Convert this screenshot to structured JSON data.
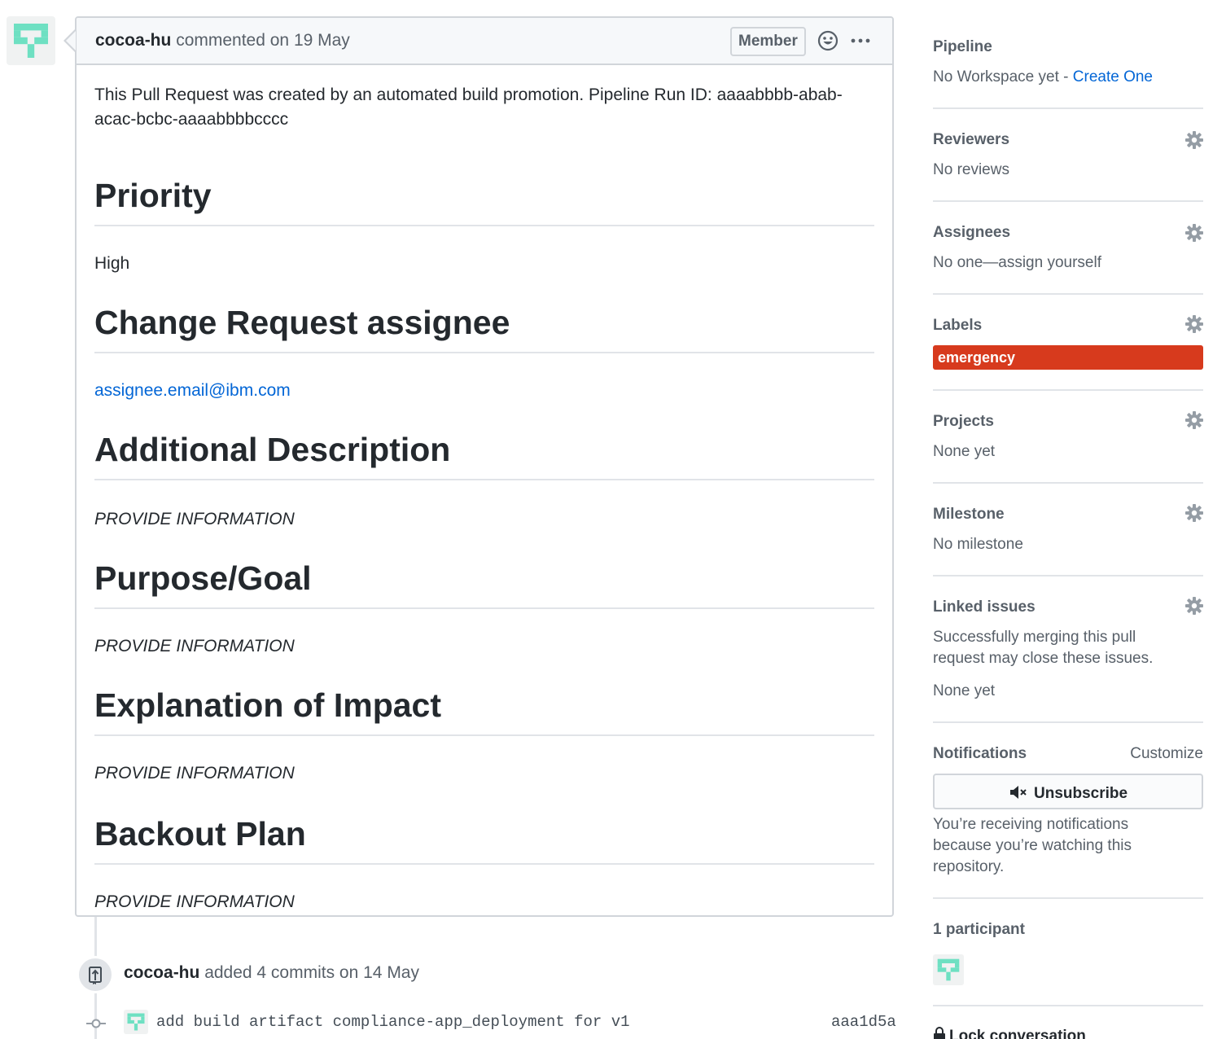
{
  "comment": {
    "author": "cocoa-hu",
    "action": "commented",
    "date": "on 19 May",
    "badge": "Member",
    "intro": "This Pull Request was created by an automated build promotion. Pipeline Run ID: aaaabbbb-abab-acac-bcbc-aaaabbbbcccc",
    "sections": [
      {
        "heading": "Priority",
        "value": "High"
      },
      {
        "heading": "Change Request assignee",
        "value": "assignee.email@ibm.com"
      },
      {
        "heading": "Additional Description",
        "value": "PROVIDE INFORMATION"
      },
      {
        "heading": "Purpose/Goal",
        "value": "PROVIDE INFORMATION"
      },
      {
        "heading": "Explanation of Impact",
        "value": "PROVIDE INFORMATION"
      },
      {
        "heading": "Backout Plan",
        "value": "PROVIDE INFORMATION"
      }
    ]
  },
  "timeline": {
    "event_author": "cocoa-hu",
    "event_text": "added 4 commits on 14 May",
    "commit_message": "add build artifact compliance-app_deployment for v1",
    "commit_sha": "aaa1d5a"
  },
  "sidebar": {
    "pipeline": {
      "title": "Pipeline",
      "value": "No Workspace yet - ",
      "link": "Create One"
    },
    "reviewers": {
      "title": "Reviewers",
      "value": "No reviews"
    },
    "assignees": {
      "title": "Assignees",
      "value": "No one—assign yourself"
    },
    "labels": {
      "title": "Labels",
      "items": [
        "emergency"
      ]
    },
    "projects": {
      "title": "Projects",
      "value": "None yet"
    },
    "milestone": {
      "title": "Milestone",
      "value": "No milestone"
    },
    "linked_issues": {
      "title": "Linked issues",
      "desc_line1": "Successfully merging this pull",
      "desc_line2": "request may close these issues.",
      "value": "None yet"
    },
    "notifications": {
      "title": "Notifications",
      "customize": "Customize",
      "button": "Unsubscribe",
      "reason_line1": "You’re receiving notifications",
      "reason_line2": "because you’re watching this",
      "reason_line3": "repository."
    },
    "participants": {
      "title": "1 participant"
    },
    "lock": {
      "label": "Lock conversation"
    }
  },
  "colors": {
    "link": "#0366d6",
    "label_emergency": "#d73a1d",
    "identicon": "#6ee0c2",
    "border": "#d1d5da"
  },
  "icons": [
    "gear-icon",
    "smiley-icon",
    "kebab-icon",
    "mute-icon",
    "push-icon",
    "lock-icon",
    "commit-icon"
  ]
}
